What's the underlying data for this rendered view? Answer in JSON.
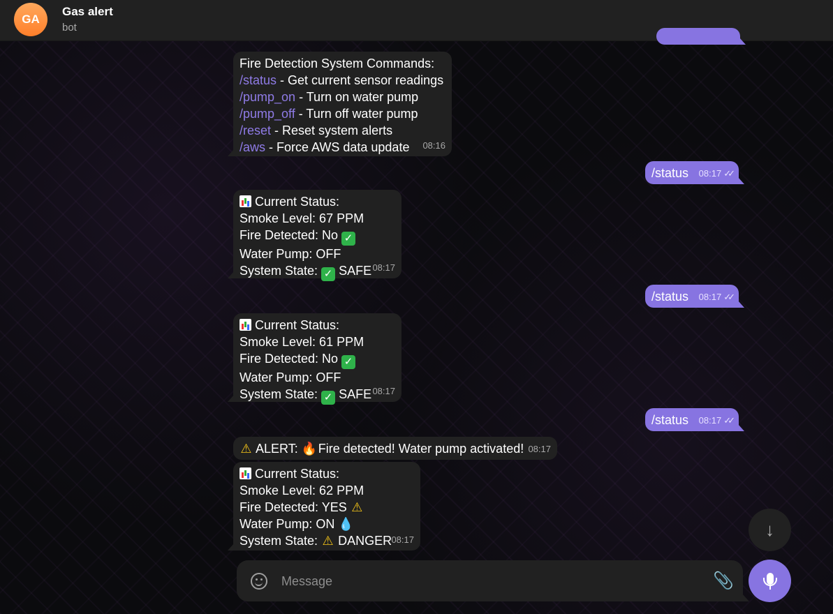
{
  "header": {
    "avatar_initials": "GA",
    "title": "Gas alert",
    "subtitle": "bot"
  },
  "messages": {
    "m1": {
      "title": "Fire Detection System Commands:",
      "lines": [
        {
          "cmd": "/status",
          "text": " - Get current sensor readings"
        },
        {
          "cmd": "/pump_on",
          "text": " - Turn on water pump"
        },
        {
          "cmd": "/pump_off",
          "text": " - Turn off water pump"
        },
        {
          "cmd": "/reset",
          "text": " - Reset system alerts"
        },
        {
          "cmd": "/aws",
          "text": " - Force AWS data update"
        }
      ],
      "time": "08:16"
    },
    "o1": {
      "text": "/status",
      "time": "08:17"
    },
    "s1": {
      "head": "Current Status:",
      "smoke": "Smoke Level: 67 PPM",
      "fire": "Fire Detected: No",
      "pump": "Water Pump: OFF",
      "state_label": "System State:",
      "state": "SAFE",
      "time": "08:17"
    },
    "o2": {
      "text": "/status",
      "time": "08:17"
    },
    "s2": {
      "head": "Current Status:",
      "smoke": "Smoke Level: 61 PPM",
      "fire": "Fire Detected: No",
      "pump": "Water Pump: OFF",
      "state_label": "System State:",
      "state": "SAFE",
      "time": "08:17"
    },
    "o3": {
      "text": "/status",
      "time": "08:17"
    },
    "alert": {
      "label": "ALERT:",
      "text": "Fire detected! Water pump activated!",
      "time": "08:17"
    },
    "s3": {
      "head": "Current Status:",
      "smoke": "Smoke Level: 62 PPM",
      "fire": "Fire Detected: YES",
      "pump": "Water Pump: ON",
      "state_label": "System State:",
      "state": "DANGER",
      "time": "08:17"
    }
  },
  "composer": {
    "placeholder": "Message"
  },
  "icons": {
    "chart": "bar-chart-emoji",
    "check": "check-mark-emoji",
    "warning": "warning-emoji",
    "fire": "fire-emoji",
    "droplet": "droplet-emoji",
    "read_ticks": "double-check-icon"
  },
  "colors": {
    "accent": "#8774e1",
    "incoming_bubble": "#212121",
    "header": "#212121",
    "avatar": "#ff8c3a"
  }
}
